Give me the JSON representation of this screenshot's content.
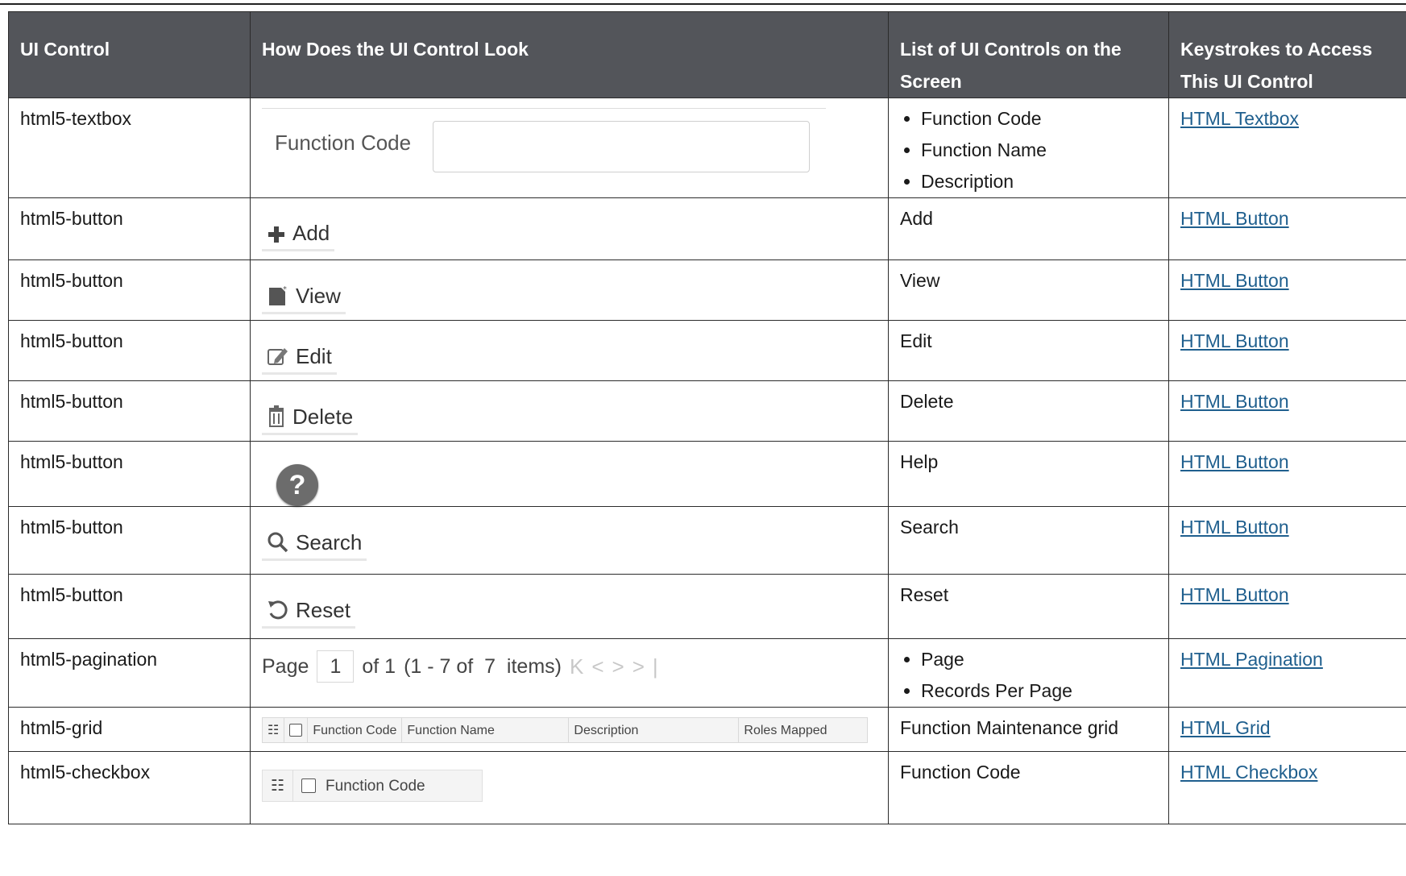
{
  "headers": [
    "UI Control",
    "How Does the UI Control Look",
    "List of UI Controls on the Screen",
    "Keystrokes to Access This UI Control"
  ],
  "rows": [
    {
      "control": "html5-textbox",
      "preview": {
        "label": "Function Code"
      },
      "list": [
        "Function Code",
        "Function Name",
        "Description"
      ],
      "link": "HTML Textbox"
    },
    {
      "control": "html5-button",
      "preview": {
        "label": "Add",
        "icon": "plus-icon"
      },
      "list_text": "Add",
      "link": "HTML Button"
    },
    {
      "control": "html5-button",
      "preview": {
        "label": "View",
        "icon": "view-document-icon"
      },
      "list_text": "View",
      "link": "HTML Button"
    },
    {
      "control": "html5-button",
      "preview": {
        "label": "Edit",
        "icon": "edit-pencil-icon"
      },
      "list_text": "Edit",
      "link": "HTML Button"
    },
    {
      "control": "html5-button",
      "preview": {
        "label": "Delete",
        "icon": "trash-icon"
      },
      "list_text": "Delete",
      "link": "HTML Button"
    },
    {
      "control": "html5-button",
      "preview": {
        "label": "?",
        "icon": "help-icon"
      },
      "list_text": "Help",
      "link": "HTML Button"
    },
    {
      "control": "html5-button",
      "preview": {
        "label": "Search",
        "icon": "search-icon"
      },
      "list_text": "Search",
      "link": "HTML Button"
    },
    {
      "control": "html5-button",
      "preview": {
        "label": "Reset",
        "icon": "reset-icon"
      },
      "list_text": "Reset",
      "link": "HTML Button"
    },
    {
      "control": "html5-pagination",
      "preview": {
        "page_label": "Page",
        "page_value": "1",
        "of_text": "of 1",
        "range_text": "(1 - 7 of  7  items)"
      },
      "list": [
        "Page",
        "Records Per Page"
      ],
      "link": "HTML Pagination"
    },
    {
      "control": "html5-grid",
      "preview": {
        "columns": [
          "Function Code",
          "Function Name",
          "Description",
          "Roles Mapped"
        ]
      },
      "list_text": "Function Maintenance grid",
      "link": "HTML Grid"
    },
    {
      "control": "html5-checkbox",
      "preview": {
        "label": "Function Code"
      },
      "list_text": "Function Code",
      "link": "HTML Checkbox"
    }
  ],
  "colors": {
    "header_bg": "#53555a",
    "link": "#1f5f8e"
  }
}
